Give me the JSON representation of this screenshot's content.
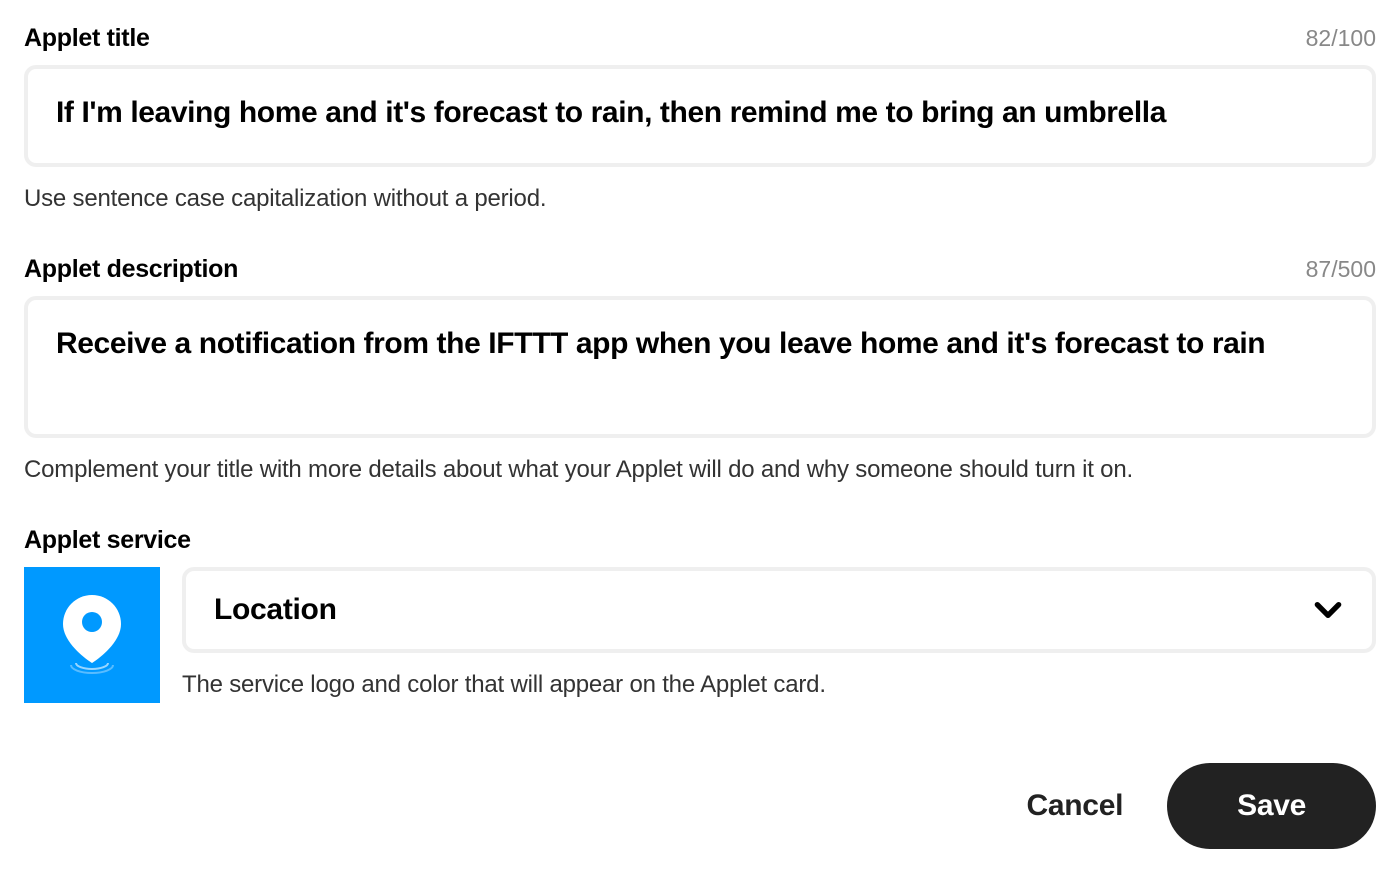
{
  "title": {
    "label": "Applet title",
    "count": "82/100",
    "value": "If I'm leaving home and it's forecast to rain, then remind me to bring an umbrella",
    "helper": "Use sentence case capitalization without a period."
  },
  "description": {
    "label": "Applet description",
    "count": "87/500",
    "value": "Receive a notification from the IFTTT app when you leave home and it's forecast to rain",
    "helper": "Complement your title with more details about what your Applet will do and why someone should turn it on."
  },
  "service": {
    "label": "Applet service",
    "selected": "Location",
    "helper": "The service logo and color that will appear on the Applet card.",
    "icon_color": "#0099ff"
  },
  "buttons": {
    "cancel": "Cancel",
    "save": "Save"
  }
}
